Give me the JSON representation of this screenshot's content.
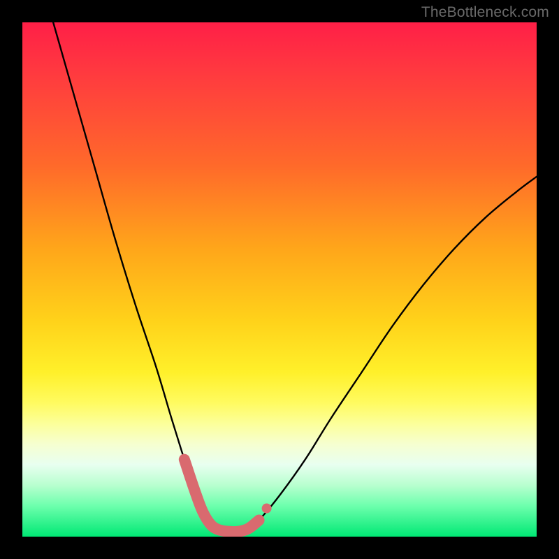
{
  "watermark": "TheBottleneck.com",
  "colors": {
    "frame": "#000000",
    "curve": "#000000",
    "highlight": "#d96a6f",
    "gradient_top": "#ff1f47",
    "gradient_bottom": "#00e874"
  },
  "chart_data": {
    "type": "line",
    "title": "",
    "xlabel": "",
    "ylabel": "",
    "xlim": [
      0,
      100
    ],
    "ylim": [
      0,
      100
    ],
    "grid": false,
    "legend": false,
    "series": [
      {
        "name": "bottleneck-curve",
        "x": [
          6,
          10,
          14,
          18,
          22,
          26,
          29,
          31.5,
          33.5,
          35,
          36.5,
          38,
          40,
          42,
          44,
          46,
          50,
          55,
          60,
          66,
          72,
          78,
          84,
          90,
          96,
          100
        ],
        "y": [
          100,
          86,
          72,
          58,
          45,
          33,
          23,
          15,
          9,
          5,
          2.5,
          1.4,
          1,
          1,
          1.6,
          3.2,
          8,
          15,
          23,
          32,
          41,
          49,
          56,
          62,
          67,
          70
        ]
      }
    ],
    "highlight": {
      "name": "optimal-range",
      "x": [
        31.5,
        33.5,
        35,
        36.5,
        38,
        40,
        42,
        44,
        46
      ],
      "y": [
        15,
        9,
        5,
        2.5,
        1.4,
        1,
        1,
        1.6,
        3.2
      ]
    },
    "highlight_marker": {
      "x": 47.5,
      "y": 5.5
    },
    "notes": "x scale is nominal 0–100 left-to-right; y scale is 0 at bottom to 100 at top; values are estimated from pixel positions since no axes/ticks are rendered."
  }
}
